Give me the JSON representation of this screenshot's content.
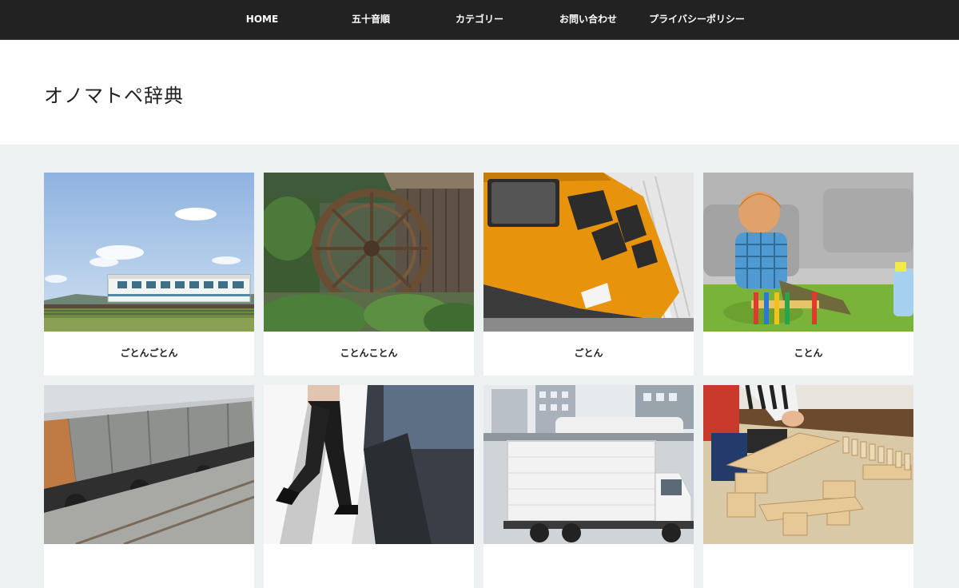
{
  "nav": {
    "items": [
      "HOME",
      "五十音順",
      "カテゴリー",
      "お問い合わせ",
      "プライバシーポリシー"
    ]
  },
  "site": {
    "title": "オノマトペ辞典"
  },
  "posts": [
    {
      "title": "ごとんごとん",
      "image": "train-countryside-image"
    },
    {
      "title": "ことんことん",
      "image": "water-wheel-image"
    },
    {
      "title": "ごとん",
      "image": "orange-tram-image"
    },
    {
      "title": "ことん",
      "image": "child-toy-image"
    },
    {
      "title": "",
      "image": "freight-train-image"
    },
    {
      "title": "",
      "image": "walking-legs-image"
    },
    {
      "title": "",
      "image": "white-truck-image"
    },
    {
      "title": "",
      "image": "wooden-blocks-image"
    }
  ],
  "colors": {
    "nav_bg": "#222222",
    "header_bg": "#ffffff",
    "page_bg": "#eef1f1",
    "tram_orange": "#e8930c"
  }
}
